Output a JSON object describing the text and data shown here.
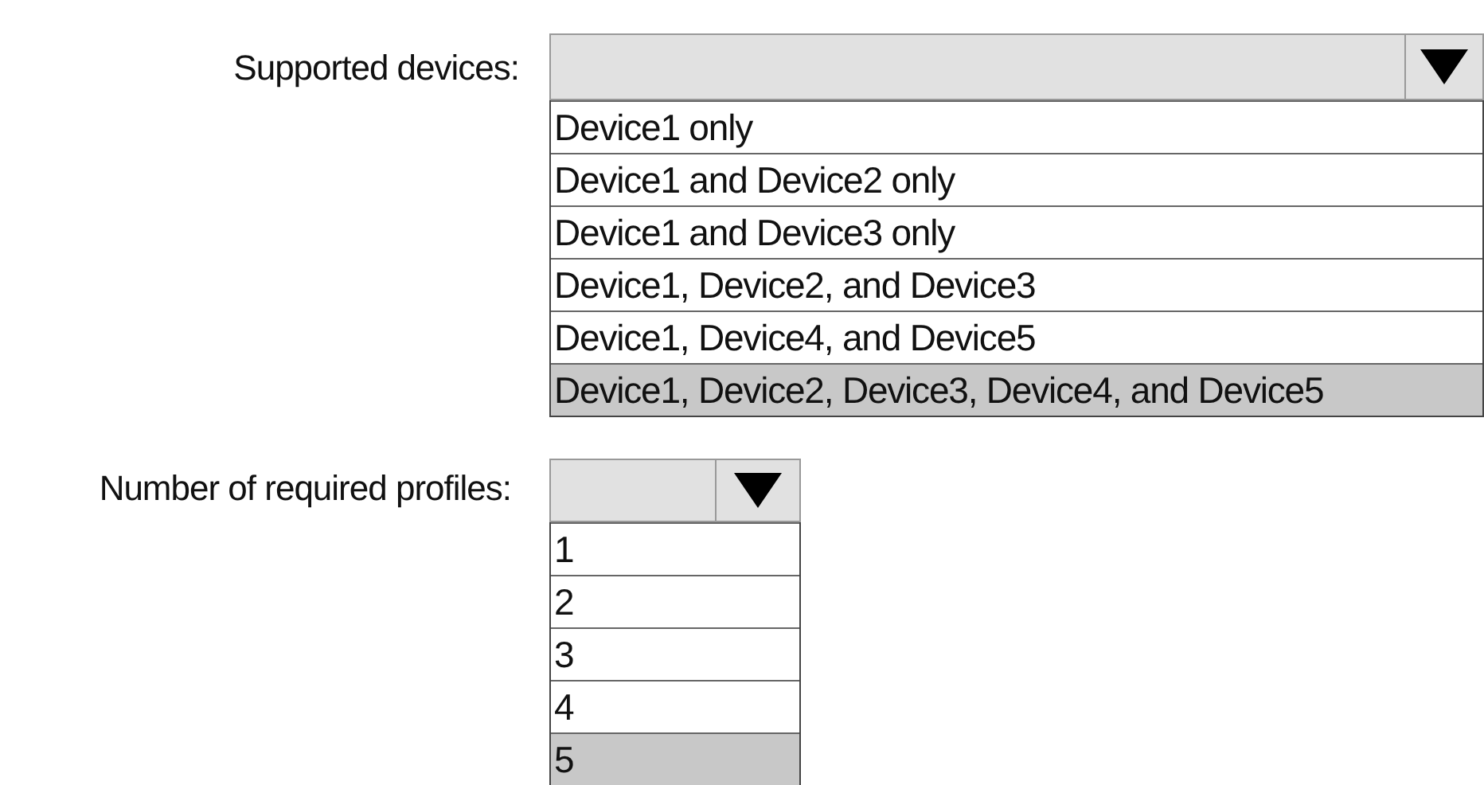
{
  "questions": [
    {
      "label": "Supported devices:",
      "kind": "wide",
      "options": [
        {
          "text": "Device1 only",
          "selected": false
        },
        {
          "text": "Device1 and Device2 only",
          "selected": false
        },
        {
          "text": "Device1 and Device3 only",
          "selected": false
        },
        {
          "text": "Device1, Device2, and Device3",
          "selected": false
        },
        {
          "text": "Device1, Device4, and Device5",
          "selected": false
        },
        {
          "text": "Device1, Device2, Device3, Device4, and Device5",
          "selected": true
        }
      ]
    },
    {
      "label": "Number of required profiles:",
      "kind": "narrow",
      "options": [
        {
          "text": "1",
          "selected": false
        },
        {
          "text": "2",
          "selected": false
        },
        {
          "text": "3",
          "selected": false
        },
        {
          "text": "4",
          "selected": false
        },
        {
          "text": "5",
          "selected": true
        }
      ]
    }
  ]
}
